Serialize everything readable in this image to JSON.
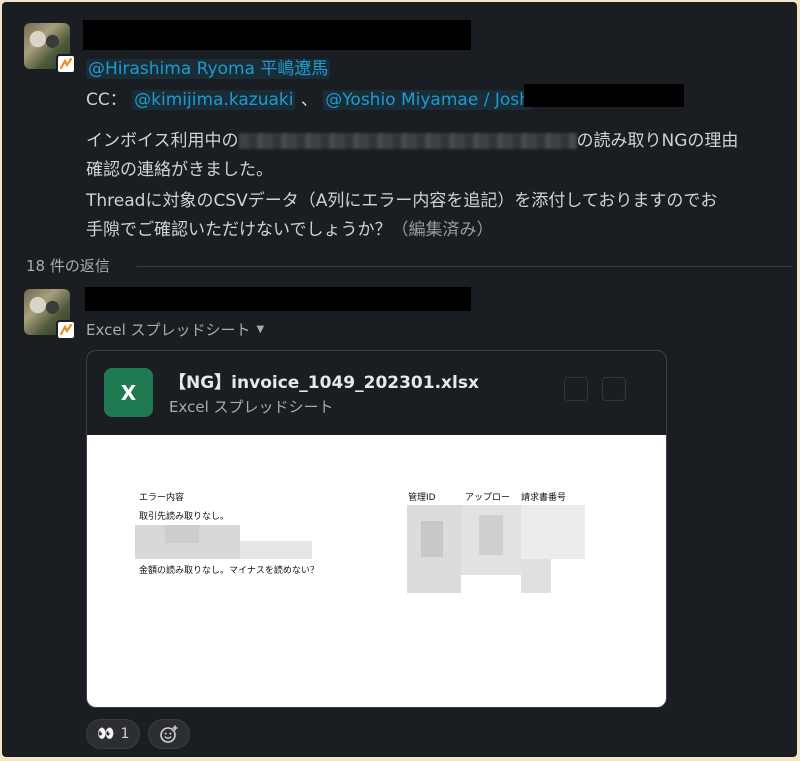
{
  "message1": {
    "mention_to": "@Hirashima Ryoma 平嶋遼馬",
    "cc_label": "CC：",
    "cc_mention_1": "@kimijima.kazuaki",
    "cc_separator": "、",
    "cc_mention_2": "@Yoshio Miyamae / Josh",
    "body_line1_prefix": "インボイス利用中の",
    "body_line1_suffix": "の読み取りNGの理由",
    "body_line2": "確認の連絡がきました。",
    "body_line3": "Threadに対象のCSVデータ（A列にエラー内容を追記）を添付しておりますのでお",
    "body_line4": "手隙でご確認いただけないでしょうか？",
    "edited_label": "（編集済み）"
  },
  "thread": {
    "replies_label": "18 件の返信"
  },
  "message2": {
    "file_type_label": "Excel スプレッドシート",
    "file": {
      "icon_letter": "X",
      "name": "【NG】invoice_1049_202301.xlsx",
      "subtitle": "Excel スプレッドシート"
    },
    "preview": {
      "col_error": "エラー内容",
      "row1": "取引先読み取りなし。",
      "row2": "金額の読み取りなし。マイナスを読めない？",
      "col_id": "管理ID",
      "col_approver": "アップロー",
      "col_invoice": "請求書番号"
    },
    "reactions": [
      {
        "emoji": "👀",
        "count": "1"
      }
    ],
    "add_reaction_icon": "emoji-add-icon"
  },
  "colors": {
    "background": "#1a1d21",
    "mention": "#1d9bd1",
    "excel_green": "#1f7a52"
  }
}
